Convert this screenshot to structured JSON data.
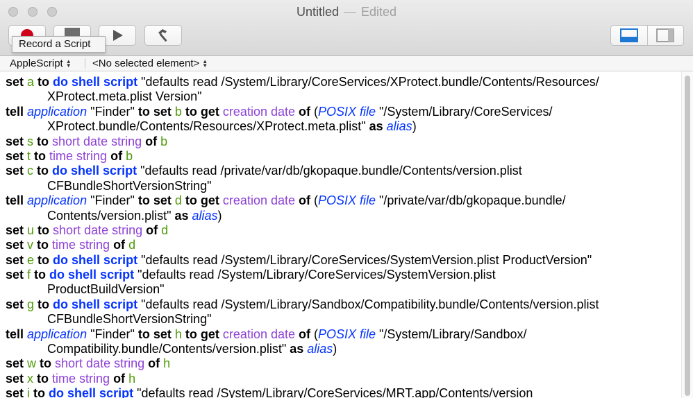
{
  "window": {
    "title": "Untitled",
    "separator": "—",
    "status": "Edited"
  },
  "toolbar": {
    "record_icon": "record-icon",
    "stop_icon": "stop-icon",
    "run_icon": "play-icon",
    "compile_icon": "hammer-icon",
    "tooltip": "Record a Script",
    "view_left_icon": "editor-bottom-pane-icon",
    "view_right_icon": "editor-side-pane-icon",
    "record_color": "#d0021b",
    "selected_color": "#1f77d4"
  },
  "navbar": {
    "language": "AppleScript",
    "element": "<No selected element>"
  },
  "code": {
    "lines": [
      {
        "cont": false,
        "tokens": [
          [
            "kw",
            "set "
          ],
          [
            "var",
            "a"
          ],
          [
            "kw",
            " to "
          ],
          [
            "cmd",
            "do shell script"
          ],
          [
            "str",
            " \"defaults read /System/Library/CoreServices/XProtect.bundle/Contents/Resources/"
          ]
        ]
      },
      {
        "cont": true,
        "tokens": [
          [
            "str",
            "XProtect.meta.plist Version\""
          ]
        ]
      },
      {
        "cont": false,
        "tokens": [
          [
            "kw",
            "tell "
          ],
          [
            "app",
            "application"
          ],
          [
            "str",
            " \"Finder\" "
          ],
          [
            "kw",
            "to set "
          ],
          [
            "var",
            "b"
          ],
          [
            "kw",
            " to get "
          ],
          [
            "prop",
            "creation date"
          ],
          [
            "kw",
            " of "
          ],
          [
            "str",
            "("
          ],
          [
            "cls",
            "POSIX file"
          ],
          [
            "str",
            " \"/System/Library/CoreServices/"
          ]
        ]
      },
      {
        "cont": true,
        "tokens": [
          [
            "str",
            "XProtect.bundle/Contents/Resources/XProtect.meta.plist\" "
          ],
          [
            "kw",
            "as "
          ],
          [
            "cls",
            "alias"
          ],
          [
            "str",
            ")"
          ]
        ]
      },
      {
        "cont": false,
        "tokens": [
          [
            "kw",
            "set "
          ],
          [
            "var",
            "s"
          ],
          [
            "kw",
            " to "
          ],
          [
            "prop",
            "short date string"
          ],
          [
            "kw",
            " of "
          ],
          [
            "var",
            "b"
          ]
        ]
      },
      {
        "cont": false,
        "tokens": [
          [
            "kw",
            "set "
          ],
          [
            "var",
            "t"
          ],
          [
            "kw",
            " to "
          ],
          [
            "prop",
            "time string"
          ],
          [
            "kw",
            " of "
          ],
          [
            "var",
            "b"
          ]
        ]
      },
      {
        "cont": false,
        "tokens": [
          [
            "kw",
            "set "
          ],
          [
            "var",
            "c"
          ],
          [
            "kw",
            " to "
          ],
          [
            "cmd",
            "do shell script"
          ],
          [
            "str",
            " \"defaults read /private/var/db/gkopaque.bundle/Contents/version.plist"
          ]
        ]
      },
      {
        "cont": true,
        "tokens": [
          [
            "str",
            "CFBundleShortVersionString\""
          ]
        ]
      },
      {
        "cont": false,
        "tokens": [
          [
            "kw",
            "tell "
          ],
          [
            "app",
            "application"
          ],
          [
            "str",
            " \"Finder\" "
          ],
          [
            "kw",
            "to set "
          ],
          [
            "var",
            "d"
          ],
          [
            "kw",
            " to get "
          ],
          [
            "prop",
            "creation date"
          ],
          [
            "kw",
            " of "
          ],
          [
            "str",
            "("
          ],
          [
            "cls",
            "POSIX file"
          ],
          [
            "str",
            " \"/private/var/db/gkopaque.bundle/"
          ]
        ]
      },
      {
        "cont": true,
        "tokens": [
          [
            "str",
            "Contents/version.plist\" "
          ],
          [
            "kw",
            "as "
          ],
          [
            "cls",
            "alias"
          ],
          [
            "str",
            ")"
          ]
        ]
      },
      {
        "cont": false,
        "tokens": [
          [
            "kw",
            "set "
          ],
          [
            "var",
            "u"
          ],
          [
            "kw",
            " to "
          ],
          [
            "prop",
            "short date string"
          ],
          [
            "kw",
            " of "
          ],
          [
            "var",
            "d"
          ]
        ]
      },
      {
        "cont": false,
        "tokens": [
          [
            "kw",
            "set "
          ],
          [
            "var",
            "v"
          ],
          [
            "kw",
            " to "
          ],
          [
            "prop",
            "time string"
          ],
          [
            "kw",
            " of "
          ],
          [
            "var",
            "d"
          ]
        ]
      },
      {
        "cont": false,
        "tokens": [
          [
            "kw",
            "set "
          ],
          [
            "var",
            "e"
          ],
          [
            "kw",
            " to "
          ],
          [
            "cmd",
            "do shell script"
          ],
          [
            "str",
            " \"defaults read /System/Library/CoreServices/SystemVersion.plist ProductVersion\""
          ]
        ]
      },
      {
        "cont": false,
        "tokens": [
          [
            "kw",
            "set "
          ],
          [
            "var",
            "f"
          ],
          [
            "kw",
            " to "
          ],
          [
            "cmd",
            "do shell script"
          ],
          [
            "str",
            " \"defaults read /System/Library/CoreServices/SystemVersion.plist"
          ]
        ]
      },
      {
        "cont": true,
        "tokens": [
          [
            "str",
            "ProductBuildVersion\""
          ]
        ]
      },
      {
        "cont": false,
        "tokens": [
          [
            "kw",
            "set "
          ],
          [
            "var",
            "g"
          ],
          [
            "kw",
            " to "
          ],
          [
            "cmd",
            "do shell script"
          ],
          [
            "str",
            " \"defaults read /System/Library/Sandbox/Compatibility.bundle/Contents/version.plist"
          ]
        ]
      },
      {
        "cont": true,
        "tokens": [
          [
            "str",
            "CFBundleShortVersionString\""
          ]
        ]
      },
      {
        "cont": false,
        "tokens": [
          [
            "kw",
            "tell "
          ],
          [
            "app",
            "application"
          ],
          [
            "str",
            " \"Finder\" "
          ],
          [
            "kw",
            "to set "
          ],
          [
            "var",
            "h"
          ],
          [
            "kw",
            " to get "
          ],
          [
            "prop",
            "creation date"
          ],
          [
            "kw",
            " of "
          ],
          [
            "str",
            "("
          ],
          [
            "cls",
            "POSIX file"
          ],
          [
            "str",
            " \"/System/Library/Sandbox/"
          ]
        ]
      },
      {
        "cont": true,
        "tokens": [
          [
            "str",
            "Compatibility.bundle/Contents/version.plist\" "
          ],
          [
            "kw",
            "as "
          ],
          [
            "cls",
            "alias"
          ],
          [
            "str",
            ")"
          ]
        ]
      },
      {
        "cont": false,
        "tokens": [
          [
            "kw",
            "set "
          ],
          [
            "var",
            "w"
          ],
          [
            "kw",
            " to "
          ],
          [
            "prop",
            "short date string"
          ],
          [
            "kw",
            " of "
          ],
          [
            "var",
            "h"
          ]
        ]
      },
      {
        "cont": false,
        "tokens": [
          [
            "kw",
            "set "
          ],
          [
            "var",
            "x"
          ],
          [
            "kw",
            " to "
          ],
          [
            "prop",
            "time string"
          ],
          [
            "kw",
            " of "
          ],
          [
            "var",
            "h"
          ]
        ]
      },
      {
        "cont": false,
        "tokens": [
          [
            "kw",
            "set "
          ],
          [
            "var",
            "i"
          ],
          [
            "kw",
            " to "
          ],
          [
            "cmd",
            "do shell script"
          ],
          [
            "str",
            " \"defaults read /System/Library/CoreServices/MRT.app/Contents/version"
          ]
        ]
      }
    ]
  }
}
